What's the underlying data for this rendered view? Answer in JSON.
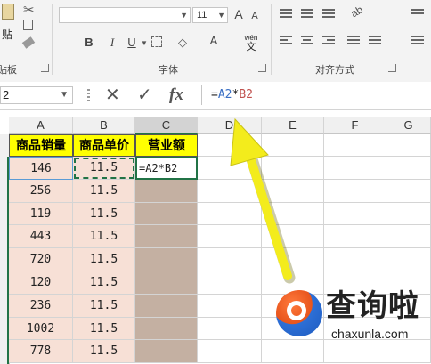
{
  "ribbon": {
    "paste_label": "贴",
    "clipboard_label": "剪贴板",
    "font_group_label": "字体",
    "align_group_label": "对齐方式",
    "font_size": "11",
    "grow_font": "A",
    "shrink_font": "A",
    "bold": "B",
    "italic": "I",
    "underline": "U",
    "wen_label": "wén",
    "wen_char": "文"
  },
  "formula_bar": {
    "name_box": "2",
    "cancel_icon": "close-icon",
    "enter_icon": "check-icon",
    "fx_label": "fx",
    "formula_prefix": "=",
    "ref_a": "A2",
    "operator": "*",
    "ref_b": "B2"
  },
  "columns": [
    "A",
    "B",
    "C",
    "D",
    "E",
    "F",
    "G"
  ],
  "table": {
    "headers": [
      "商品销量",
      "商品单价",
      "营业额"
    ],
    "col_a": [
      "146",
      "256",
      "119",
      "443",
      "720",
      "120",
      "236",
      "1002",
      "778"
    ],
    "col_b": [
      "11.5",
      "11.5",
      "11.5",
      "11.5",
      "11.5",
      "11.5",
      "11.5",
      "11.5",
      "11.5"
    ],
    "c_active_text": "=A2*B2"
  },
  "watermark": {
    "title": "查询啦",
    "url": "chaxunla.com"
  },
  "colors": {
    "header_yellow": "#ffff00",
    "data_fill": "#f7e0d6",
    "result_fill": "#c4b0a2",
    "excel_green": "#217346",
    "arrow_yellow": "#f3ec1c"
  }
}
